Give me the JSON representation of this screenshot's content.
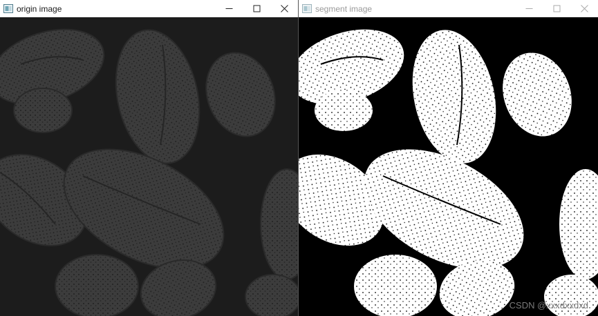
{
  "windows": [
    {
      "title": "origin image"
    },
    {
      "title": "segment image"
    }
  ],
  "controls": {
    "minimize_icon": "minimize-icon",
    "maximize_icon": "maximize-icon",
    "close_icon": "close-icon"
  },
  "watermark": "CSDN @xxxdxxdxd",
  "colors": {
    "origin_background": "#1c1c1c",
    "origin_grain": "#3a3a3a",
    "segment_background": "#000000",
    "segment_grain": "#ffffff"
  }
}
